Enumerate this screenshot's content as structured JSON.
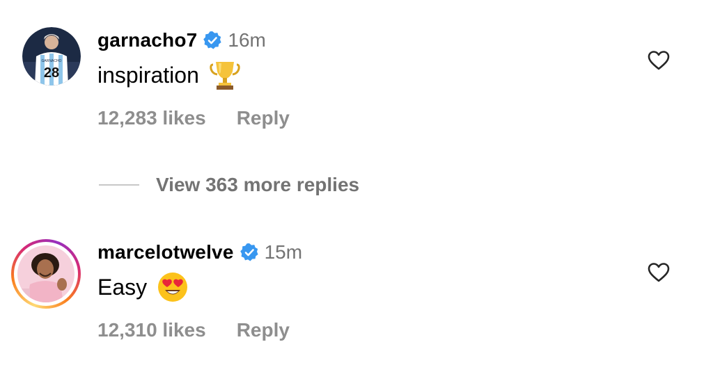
{
  "comments": [
    {
      "username": "garnacho7",
      "time": "16m",
      "text": "inspiration",
      "emoji_icon": "trophy-icon",
      "likes": "12,283 likes",
      "reply_label": "Reply",
      "view_replies": "View 363 more replies",
      "avatar_bg": "#1c2a44",
      "avatar_jersey_number": "28",
      "avatar_jersey_name": "GARNACHO"
    },
    {
      "username": "marcelotwelve",
      "time": "15m",
      "text": "Easy",
      "emoji_icon": "heart-eyes-emoji-icon",
      "likes": "12,310 likes",
      "reply_label": "Reply",
      "avatar_bg": "#f6d0dc",
      "story_ring_colors": [
        "#feda75",
        "#fa7e1e",
        "#d62976",
        "#962fbf"
      ]
    }
  ],
  "colors": {
    "verified_badge": "#3897f0",
    "secondary_text": "#737373",
    "meta_text": "#8e8e8e",
    "heart_outline": "#262626"
  }
}
